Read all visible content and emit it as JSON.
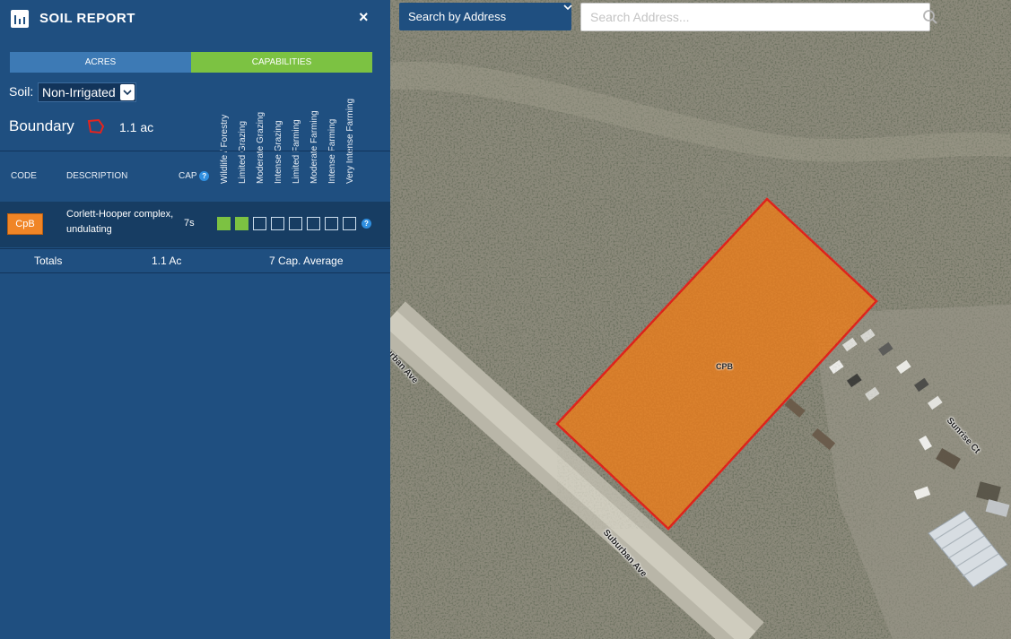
{
  "panel": {
    "title": "SOIL REPORT",
    "close_label": "×",
    "tabs": [
      {
        "label": "ACRES",
        "active": false
      },
      {
        "label": "CAPABILITIES",
        "active": true
      }
    ],
    "soil_label": "Soil:",
    "soil_value": "Non-Irrigated",
    "boundary_label": "Boundary",
    "boundary_acres": "1.1 ac",
    "capability_headers": [
      "Wildlife / Forestry",
      "Limited Grazing",
      "Moderate Grazing",
      "Intense Grazing",
      "Limited Farming",
      "Moderate Farming",
      "Intense Farming",
      "Very Intense Farming"
    ],
    "columns": {
      "code": "CODE",
      "description": "DESCRIPTION",
      "cap": "CAP"
    },
    "rows": [
      {
        "code": "CpB",
        "description": "Corlett-Hooper complex, undulating",
        "cap": "7s",
        "filled": 2
      }
    ],
    "totals": {
      "label": "Totals",
      "acres": "1.1 Ac",
      "average": "7 Cap. Average"
    },
    "colors": {
      "panel_bg": "#1f4f80",
      "tab_active": "#7cc242",
      "tab_inactive": "#3d7ab5",
      "code_badge": "#f08526"
    }
  },
  "map": {
    "search_mode": "Search by Address",
    "search_placeholder": "Search Address...",
    "parcel_label": "CPB",
    "roads": [
      "Suburban Ave",
      "Suburban Ave",
      "Sunrise Ct"
    ],
    "colors": {
      "parcel_fill": "#f08526",
      "parcel_outline": "#e8231c"
    }
  }
}
